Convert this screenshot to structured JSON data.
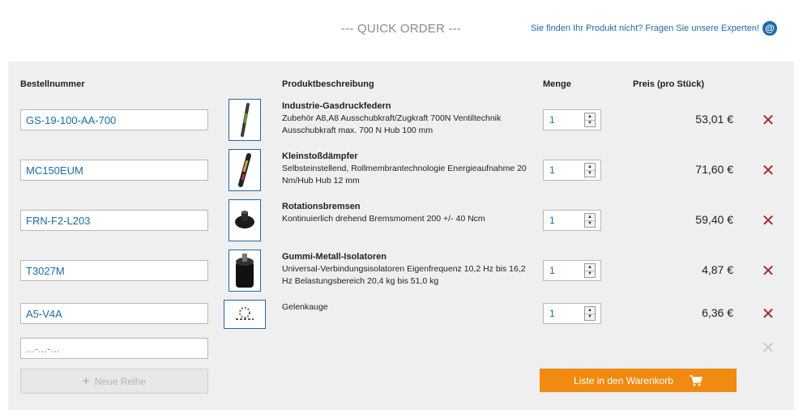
{
  "header": {
    "title": "--- QUICK ORDER ---",
    "expert_link": "Sie finden Ihr Produkt nicht? Fragen Sie unsere Experten!",
    "expert_icon": "at-icon"
  },
  "columns": {
    "sku": "Bestellnummer",
    "description": "Produktbeschreibung",
    "quantity": "Menge",
    "price": "Preis (pro Stück)"
  },
  "rows": [
    {
      "sku": "GS-19-100-AA-700",
      "title": "Industrie-Gasdruckfedern",
      "text": "Zubehör A8,A8 Ausschubkraft/Zugkraft 700N Ventiltechnik Ausschubkraft max. 700 N Hub 100 mm",
      "qty": "1",
      "price": "53,01 €"
    },
    {
      "sku": "MC150EUM",
      "title": "Kleinstoßdämpfer",
      "text": "Selbsteinstellend, Rollmembrantechnologie Energieaufnahme 20 Nm/Hub Hub 12 mm",
      "qty": "1",
      "price": "71,60 €"
    },
    {
      "sku": "FRN-F2-L203",
      "title": "Rotationsbremsen",
      "text": "Kontinuierlich drehend Bremsmoment 200 +/- 40 Ncm",
      "qty": "1",
      "price": "59,40 €"
    },
    {
      "sku": "T3027M",
      "title": "Gummi-Metall-Isolatoren",
      "text": "Universal-Verbindungsisolatoren Eigenfrequenz 10,2 Hz bis 16,2 Hz Belastungsbereich 20,4 kg bis 51,0 kg",
      "qty": "1",
      "price": "4,87 €"
    },
    {
      "sku": "A5-V4A",
      "title": "",
      "text": "Gelenkauge",
      "qty": "1",
      "price": "6,36 €"
    }
  ],
  "empty_row": {
    "placeholder": "...-...-..."
  },
  "buttons": {
    "new_row": "Neue Reihe",
    "add_to_cart": "Liste in den Warenkorb"
  },
  "colors": {
    "accent": "#1f6aa8",
    "cart": "#f08a10",
    "delete": "#a52a2a"
  }
}
